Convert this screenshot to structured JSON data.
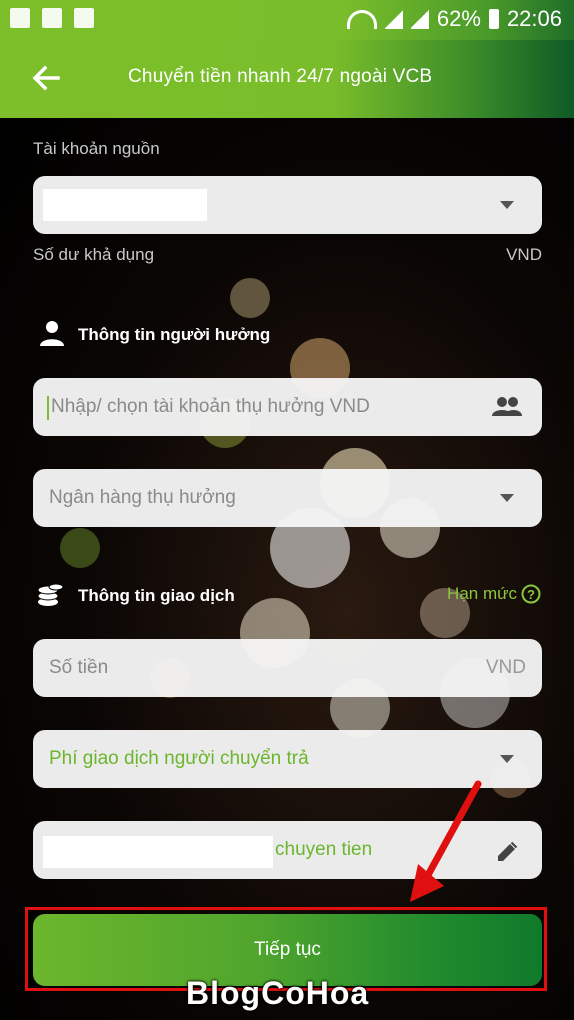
{
  "status_bar": {
    "battery_percent": "62%",
    "time": "22:06"
  },
  "header": {
    "title": "Chuyển tiền nhanh 24/7 ngoài VCB",
    "back_icon": "arrow-left-icon"
  },
  "source_account": {
    "label": "Tài khoản nguồn",
    "available_balance_label": "Số dư khả dụng",
    "currency": "VND"
  },
  "beneficiary": {
    "section_title": "Thông tin người hưởng",
    "account_placeholder": "Nhập/ chọn tài khoản thụ hưởng VND",
    "bank_placeholder": "Ngân hàng thụ hưởng"
  },
  "transaction": {
    "section_title": "Thông tin giao dịch",
    "limit_link": "Hạn mức",
    "amount_placeholder": "Số tiền",
    "amount_currency": "VND",
    "fee_option": "Phí giao dịch người chuyển trả",
    "note_suffix": "chuyen tien"
  },
  "continue_button": "Tiếp tục",
  "watermark": "BlogCoHoa",
  "colors": {
    "accent_green": "#7cbf2a",
    "link_green": "#8cc63f",
    "highlight_red": "#e01010"
  }
}
